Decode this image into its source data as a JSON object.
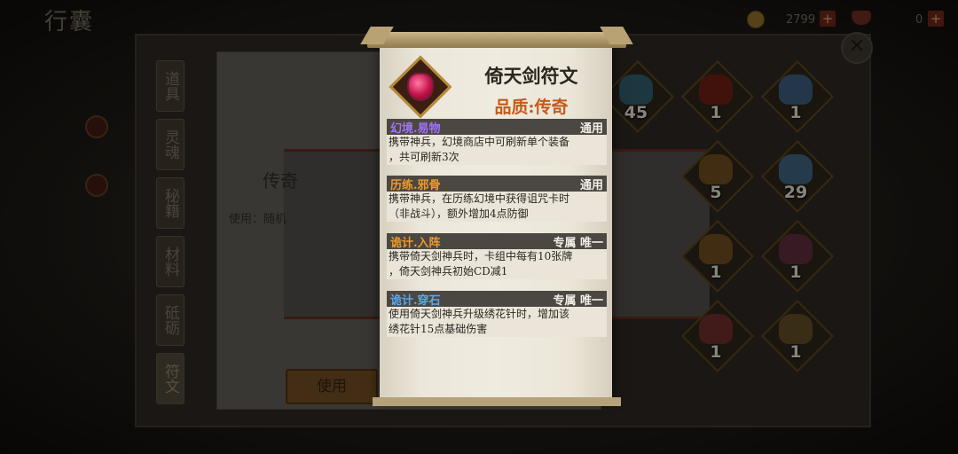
{
  "top_bar": {
    "title": "行囊",
    "coins": "2799",
    "gems": "0",
    "plus": "+"
  },
  "side_tabs": [
    "道具",
    "灵魂",
    "秘籍",
    "材料",
    "砥砺",
    "符文"
  ],
  "detail": {
    "card_title": "传奇",
    "usage_prefix": "使用：随机",
    "use_button": "使用"
  },
  "grid": {
    "counts": [
      "45",
      "1",
      "1",
      "5",
      "29",
      "1",
      "1",
      "1",
      "1"
    ]
  },
  "close_label": "✕",
  "tooltip": {
    "item_name": "倚天剑符文",
    "quality": "品质:传奇",
    "skills": [
      {
        "name": "幻境.易物",
        "tag": "通用",
        "color": "#a072ff",
        "desc_lines": [
          "携带神兵，幻境商店中可刷新单个装备",
          "，共可刷新3次"
        ]
      },
      {
        "name": "历练.邪骨",
        "tag": "通用",
        "color": "#f09a2a",
        "desc_lines": [
          "携带神兵，在历练幻境中获得诅咒卡时",
          "（非战斗），额外增加4点防御"
        ]
      },
      {
        "name": "诡计.入阵",
        "tag": "专属 唯一",
        "color": "#f09a2a",
        "desc_lines": [
          "携带倚天剑神兵时，卡组中每有10张牌",
          "，倚天剑神兵初始CD减1"
        ]
      },
      {
        "name": "诡计.穿石",
        "tag": "专属 唯一",
        "color": "#58a8f0",
        "desc_lines": [
          "使用倚天剑神兵升级绣花针时，增加该",
          "绣花针15点基础伤害"
        ]
      }
    ]
  }
}
